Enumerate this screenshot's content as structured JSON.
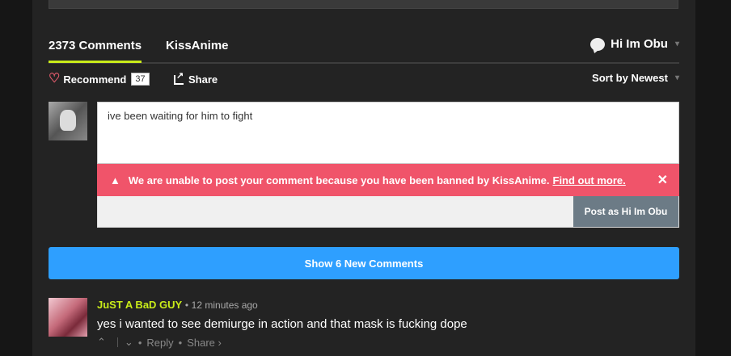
{
  "tabs": {
    "comments_label": "2373 Comments",
    "site_label": "KissAnime"
  },
  "user": {
    "name": "Hi Im Obu",
    "caret": "▾"
  },
  "actions": {
    "recommend_label": "Recommend",
    "recommend_count": "37",
    "share_label": "Share",
    "sort_label": "Sort by Newest",
    "sort_caret": "▾"
  },
  "compose": {
    "text": "ive been waiting for him to fight",
    "alert_message": "We are unable to post your comment because you have been banned by KissAnime.",
    "alert_link": "Find out more.",
    "alert_close": "✕",
    "post_button": "Post as Hi Im Obu"
  },
  "show_new_label": "Show 6 New Comments",
  "comment": {
    "author": "JuST A BaD GUY",
    "sep": "•",
    "time": "12 minutes ago",
    "body": "yes i wanted to see demiurge in action and that mask is fucking dope",
    "upvote": "⌃",
    "downvote": "⌄",
    "reply": "Reply",
    "share": "Share ›"
  },
  "colors": {
    "accent": "#c9ec19",
    "alert": "#f0546a",
    "button_blue": "#2e9fff",
    "post_button": "#6c7b86"
  }
}
